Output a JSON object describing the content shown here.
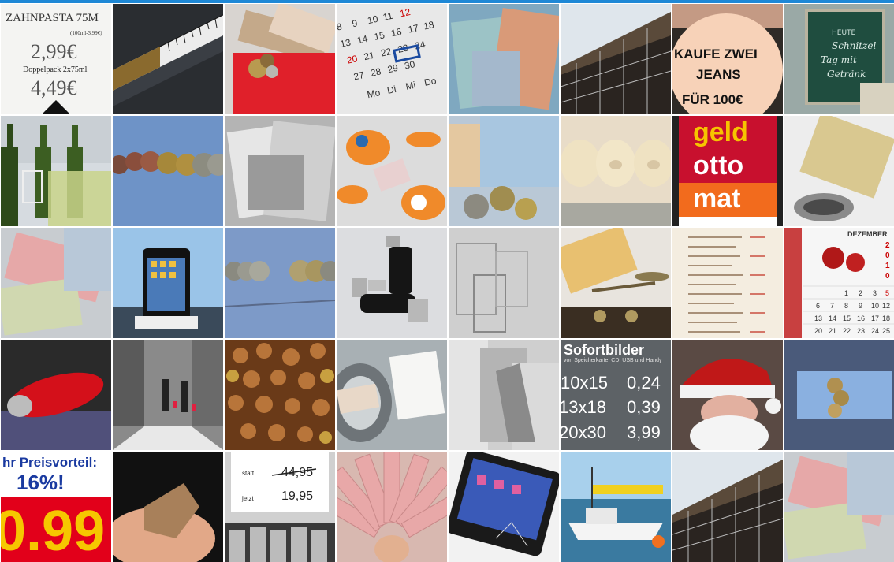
{
  "tiles": {
    "toothpaste": {
      "title": "ZAHNPASTA 75M",
      "unit_price": "(100ml-3,99€)",
      "price1": "2,99€",
      "label": "Doppelpack 2x75ml",
      "price2": "4,49€"
    },
    "jeans": {
      "line1": "KAUFE ZWEI",
      "line2": "JEANS",
      "line3": "FÜR 100€"
    },
    "chalkboard": {
      "heading": "HEUTE",
      "line1": "Schnitzel",
      "line2": "Tag mit",
      "line3": "Getränk"
    },
    "geldautomat": {
      "line1": "geld",
      "line2": "otto",
      "line3": "mat"
    },
    "calendar2": {
      "month": "DEZEMBER",
      "year": "2010"
    },
    "photos": {
      "title": "Sofortbilder",
      "subtitle": "von Speicherkarte, CD, USB und Handy",
      "row1_size": "10x15",
      "row1_price": "0,24",
      "row2_size": "13x18",
      "row2_price": "0,39",
      "row3_size": "20x30",
      "row3_price": "3,99"
    },
    "preisvorteil": {
      "line1": "hr Preisvorteil:",
      "line2": "16%!",
      "price": "0.99"
    },
    "pricetag": {
      "label_old": "statt",
      "old_price": "44,95",
      "label_new": "jetzt",
      "new_price": "19,95"
    }
  },
  "colors": {
    "accent_bar": "#1e88d6",
    "geld_red": "#c8102e",
    "geld_orange": "#f26b1d"
  }
}
